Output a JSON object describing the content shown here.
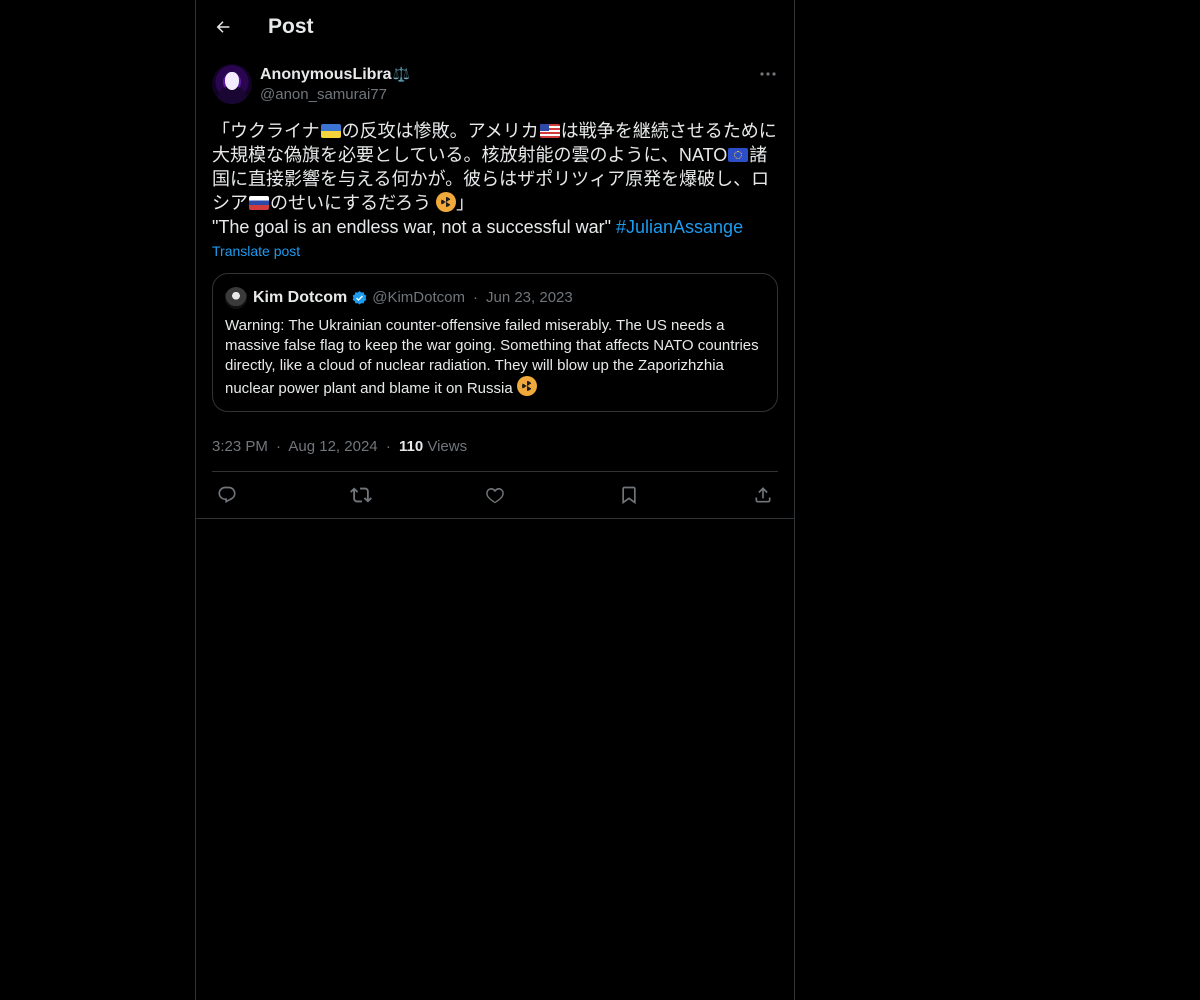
{
  "header": {
    "title": "Post"
  },
  "post": {
    "author": {
      "display_name": "AnonymousLibra",
      "name_emoji": "⚖️",
      "handle": "@anon_samurai77"
    },
    "body": {
      "line1_a": "「ウクライナ",
      "line1_b": "の反攻は惨敗。アメリカ",
      "line1_c": "は戦争を継続させるために大規模な偽旗を必要としている。核放射能の雲のように、NATO",
      "line1_d": "諸国に直接影響を与える何かが。彼らはザポリツィア原発を爆破し、ロシア",
      "line1_e": "のせいにするだろう ",
      "line1_f": "」",
      "line2_text": "\"The goal is an endless war, not a successful war\" ",
      "hashtag": "#JulianAssange"
    },
    "translate_label": "Translate post",
    "quote": {
      "name": "Kim Dotcom",
      "handle": "@KimDotcom",
      "separator": "·",
      "date": "Jun 23, 2023",
      "text": "Warning: The Ukrainian counter-offensive failed miserably. The US needs a massive false flag to keep the war going. Something that affects NATO countries directly, like a cloud of nuclear radiation. They will blow up the Zaporizhzhia nuclear power plant and blame it on Russia "
    },
    "meta": {
      "time": "3:23 PM",
      "separator": "·",
      "date": "Aug 12, 2024",
      "views_count": "110",
      "views_label": "Views"
    }
  },
  "icons": {
    "back": "arrow-left-icon",
    "more": "ellipsis-icon",
    "verified": "verified-badge-icon",
    "reply": "reply-icon",
    "repost": "repost-icon",
    "like": "heart-icon",
    "bookmark": "bookmark-icon",
    "share": "share-icon"
  },
  "colors": {
    "background": "#000000",
    "text": "#e7e9ea",
    "secondary": "#71767b",
    "accent": "#1d9bf0",
    "border": "#2f3336"
  }
}
